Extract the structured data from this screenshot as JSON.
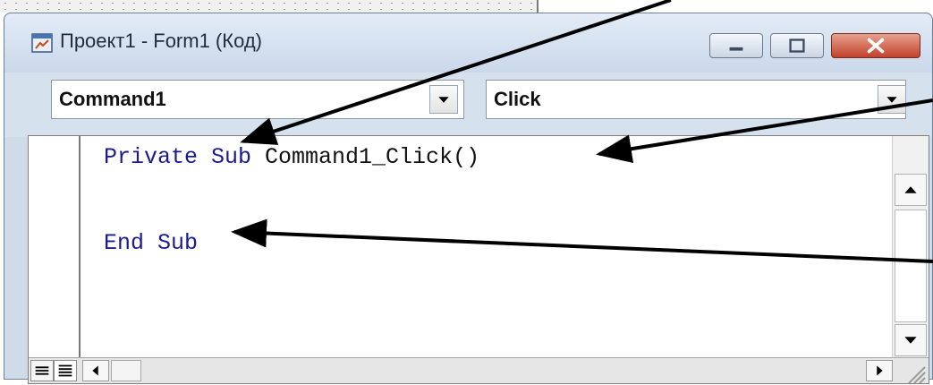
{
  "window": {
    "title": "Проект1 - Form1 (Код)"
  },
  "object_combo": {
    "value": "Command1"
  },
  "procedure_combo": {
    "value": "Click"
  },
  "code": {
    "lines": [
      {
        "keyword": "Private Sub ",
        "rest": "Command1_Click()"
      },
      {
        "keyword": "",
        "rest": ""
      },
      {
        "keyword": "End Sub",
        "rest": ""
      }
    ]
  },
  "colors": {
    "keyword": "#1b1b8f",
    "arrow": "#000000",
    "close_button": "#c2412a"
  },
  "icons": [
    "form-code-icon",
    "minimize-icon",
    "maximize-icon",
    "close-icon",
    "dropdown-arrow-icon",
    "scroll-up-icon",
    "scroll-down-icon",
    "scroll-left-icon",
    "scroll-right-icon",
    "procedure-view-icon",
    "full-module-view-icon",
    "resize-grip-icon"
  ]
}
